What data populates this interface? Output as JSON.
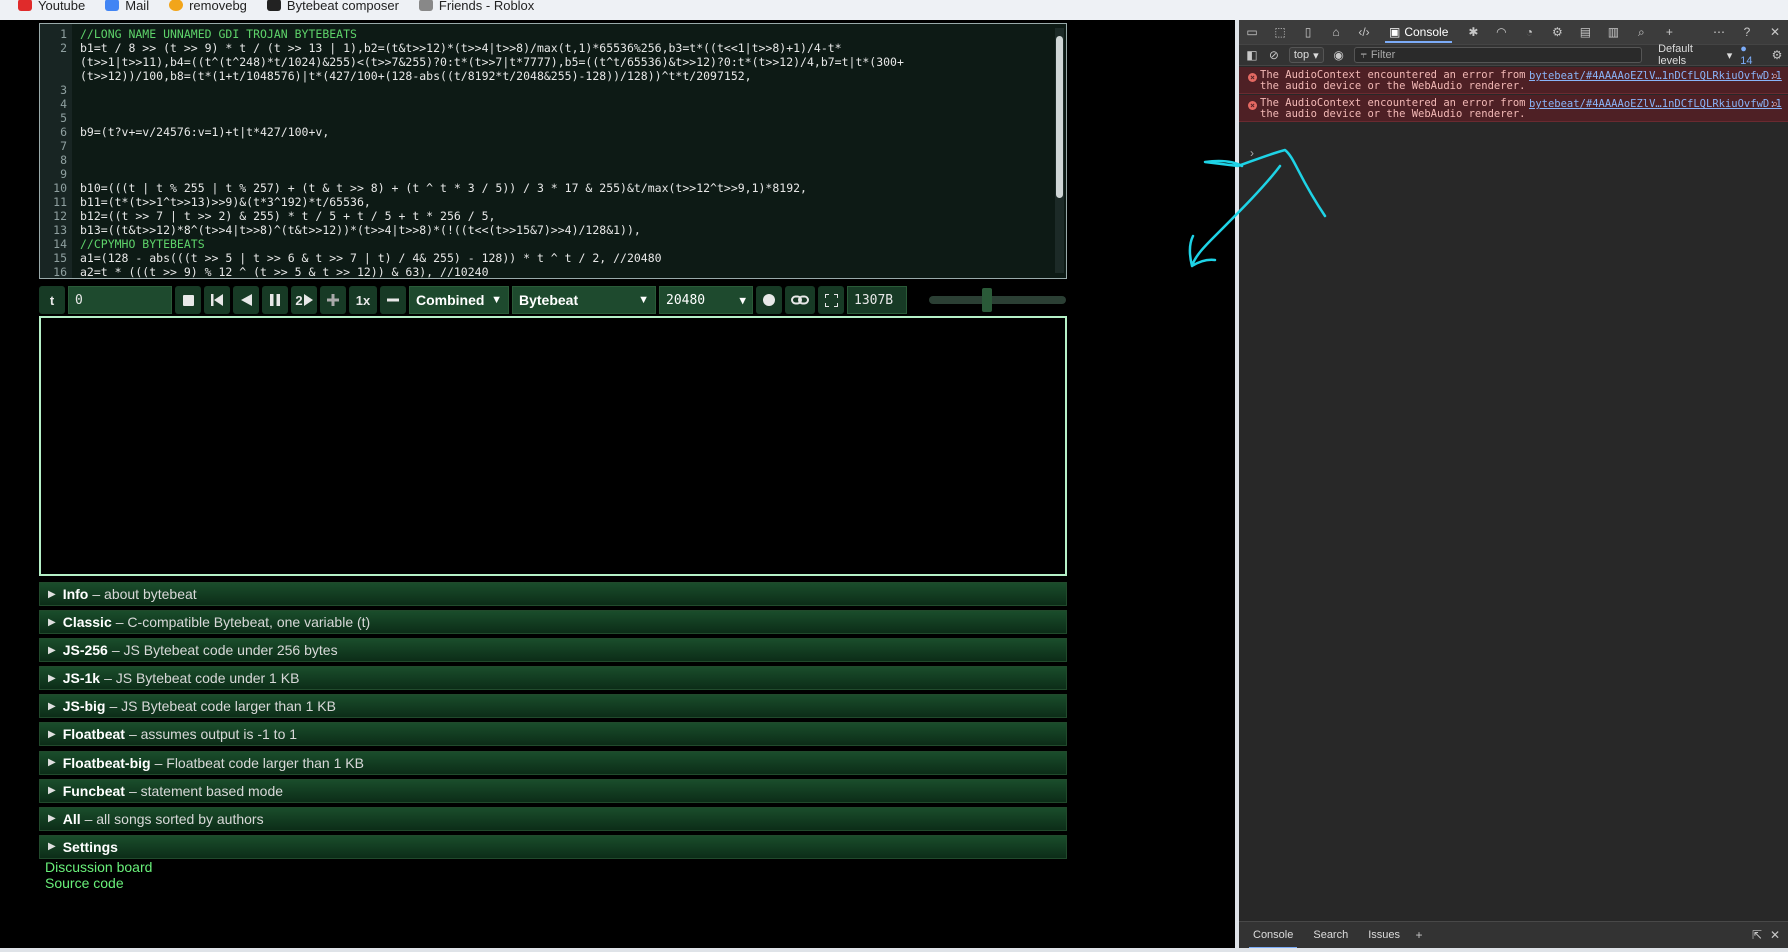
{
  "bookmarks": [
    {
      "label": "Youtube",
      "icon": "youtube-icon",
      "color": "#e02b2b"
    },
    {
      "label": "Mail",
      "icon": "mail-icon",
      "color": "#4285f4"
    },
    {
      "label": "removebg",
      "icon": "removebg-icon",
      "color": "#f2a51a"
    },
    {
      "label": "Bytebeat composer",
      "icon": "bytebeat-icon",
      "color": "#222222"
    },
    {
      "label": "Friends - Roblox",
      "icon": "roblox-icon",
      "color": "#888888"
    }
  ],
  "editor": {
    "lines": [
      {
        "n": "1",
        "text": "//LONG NAME UNNAMED GDI TROJAN BYTEBEATS",
        "comment": true
      },
      {
        "n": "2",
        "text": "b1=t / 8 >> (t >> 9) * t / (t >> 13 | 1),b2=(t&t>>12)*(t>>4|t>>8)/max(t,1)*65536%256,b3=t*((t<<1|t>>8)+1)/4-t*",
        "comment": false
      },
      {
        "n": "",
        "text": "(t>>1|t>>11),b4=((t^(t^248)*t/1024)&255)<(t>>7&255)?0:t*(t>>7|t*7777),b5=((t^t/65536)&t>>12)?0:t*(t>>12)/4,b7=t|t*(300+",
        "comment": false
      },
      {
        "n": "",
        "text": "(t>>12))/100,b8=(t*(1+t/1048576)|t*(427/100+(128-abs((t/8192*t/2048&255)-128))/128))^t*t/2097152,",
        "comment": false
      },
      {
        "n": "3",
        "text": "",
        "comment": false
      },
      {
        "n": "4",
        "text": "",
        "comment": false
      },
      {
        "n": "5",
        "text": "",
        "comment": false
      },
      {
        "n": "6",
        "text": "b9=(t?v+=v/24576:v=1)+t|t*427/100+v,",
        "comment": false
      },
      {
        "n": "7",
        "text": "",
        "comment": false
      },
      {
        "n": "8",
        "text": "",
        "comment": false
      },
      {
        "n": "9",
        "text": "",
        "comment": false
      },
      {
        "n": "10",
        "text": "b10=(((t | t % 255 | t % 257) + (t & t >> 8) + (t ^ t * 3 / 5)) / 3 * 17 & 255)&t/max(t>>12^t>>9,1)*8192,",
        "comment": false
      },
      {
        "n": "11",
        "text": "b11=(t*(t>>1^t>>13)>>9)&(t*3^192)*t/65536,",
        "comment": false
      },
      {
        "n": "12",
        "text": "b12=((t >> 7 | t >> 2) & 255) * t / 5 + t / 5 + t * 256 / 5,",
        "comment": false
      },
      {
        "n": "13",
        "text": "b13=((t&t>>12)*8^(t>>4|t>>8)^(t&t>>12))*(t>>4|t>>8)*(!((t<<(t>>15&7)>>4)/128&1)),",
        "comment": false
      },
      {
        "n": "14",
        "text": "//CPYMHO BYTEBEATS",
        "comment": true
      },
      {
        "n": "15",
        "text": "a1=(128 - abs(((t >> 5 | t >> 6 & t >> 7 | t) / 4& 255) - 128)) * t ^ t / 2, //20480",
        "comment": false
      },
      {
        "n": "16",
        "text": "a2=t * (((t >> 9) % 12 ^ (t >> 5 & t >> 12)) & 63), //10240",
        "comment": false
      }
    ]
  },
  "controls": {
    "t_label": "t",
    "t_value": "0",
    "speed_label": "2",
    "playback_rate": "1x",
    "mode": "Combined",
    "type": "Bytebeat",
    "sample_rate": "20480",
    "size": "1307B",
    "volume": 0.42
  },
  "sections": [
    {
      "title": "Info",
      "desc": "– about bytebeat"
    },
    {
      "title": "Classic",
      "desc": "– C-compatible Bytebeat, one variable (t)"
    },
    {
      "title": "JS-256",
      "desc": "– JS Bytebeat code under 256 bytes"
    },
    {
      "title": "JS-1k",
      "desc": "– JS Bytebeat code under 1 KB"
    },
    {
      "title": "JS-big",
      "desc": "– JS Bytebeat code larger than 1 KB"
    },
    {
      "title": "Floatbeat",
      "desc": "– assumes output is -1 to 1"
    },
    {
      "title": "Floatbeat-big",
      "desc": "– Floatbeat code larger than 1 KB"
    },
    {
      "title": "Funcbeat",
      "desc": "– statement based mode"
    },
    {
      "title": "All",
      "desc": "– all songs sorted by authors"
    },
    {
      "title": "Settings",
      "desc": ""
    }
  ],
  "links": {
    "discussion": "Discussion board",
    "source": "Source code"
  },
  "devtools": {
    "console_tab": "Console",
    "context": "top",
    "filter_placeholder": "Filter",
    "levels": "Default levels",
    "issues_count": "14",
    "errors": [
      {
        "message": "The AudioContext encountered an error from the audio device or the WebAudio renderer.",
        "source": "bytebeat/#4AAAAoEZlV…1nDCfLQLRkiuOvfwD:1"
      },
      {
        "message": "The AudioContext encountered an error from the audio device or the WebAudio renderer.",
        "source": "bytebeat/#4AAAAoEZlV…1nDCfLQLRkiuOvfwD:1"
      }
    ],
    "prompt": "›",
    "bottom_tabs": [
      "Console",
      "Search",
      "Issues"
    ]
  },
  "colors": {
    "accent": "#5ed36a",
    "error_bg": "#4e2025",
    "scribble": "#1ed3e6"
  }
}
